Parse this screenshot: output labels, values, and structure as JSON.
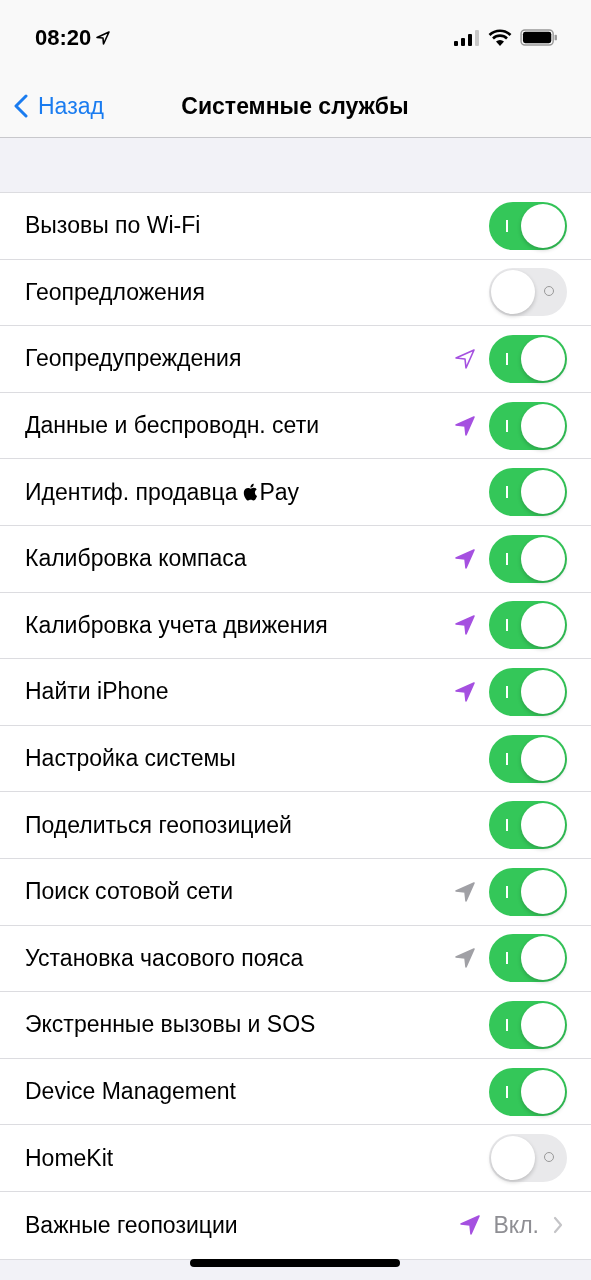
{
  "status_bar": {
    "time": "08:20",
    "location_active": true
  },
  "nav": {
    "back": "Назад",
    "title": "Системные службы"
  },
  "rows": [
    {
      "kind": "toggle",
      "label": "Вызовы по Wi-Fi",
      "on": true
    },
    {
      "kind": "toggle",
      "label": "Геопредложения",
      "on": false
    },
    {
      "kind": "toggle",
      "label": "Геопредупреждения",
      "location_icon": {
        "filled": false,
        "color": "#a550e0"
      },
      "on": true
    },
    {
      "kind": "toggle",
      "label": "Данные и беспроводн. сети",
      "location_icon": {
        "filled": true,
        "color": "#a550e0"
      },
      "on": true
    },
    {
      "kind": "toggle",
      "label": "Идентиф. продавца",
      "brand_suffix": "Pay",
      "on": true
    },
    {
      "kind": "toggle",
      "label": "Калибровка компаса",
      "location_icon": {
        "filled": true,
        "color": "#a550e0"
      },
      "on": true
    },
    {
      "kind": "toggle",
      "label": "Калибровка учета движения",
      "location_icon": {
        "filled": true,
        "color": "#a550e0"
      },
      "on": true
    },
    {
      "kind": "toggle",
      "label": "Найти iPhone",
      "location_icon": {
        "filled": true,
        "color": "#a550e0"
      },
      "on": true
    },
    {
      "kind": "toggle",
      "label": "Настройка системы",
      "on": true
    },
    {
      "kind": "toggle",
      "label": "Поделиться геопозицией",
      "on": true
    },
    {
      "kind": "toggle",
      "label": "Поиск сотовой сети",
      "location_icon": {
        "filled": true,
        "color": "#a0a0a5"
      },
      "on": true
    },
    {
      "kind": "toggle",
      "label": "Установка часового пояса",
      "location_icon": {
        "filled": true,
        "color": "#a0a0a5"
      },
      "on": true
    },
    {
      "kind": "toggle",
      "label": "Экстренные вызовы и SOS",
      "on": true
    },
    {
      "kind": "toggle",
      "label": "Device Management",
      "on": true
    },
    {
      "kind": "toggle",
      "label": "HomeKit",
      "on": false
    },
    {
      "kind": "link",
      "label": "Важные геопозиции",
      "location_icon": {
        "filled": true,
        "color": "#a550e0"
      },
      "value": "Вкл."
    }
  ]
}
